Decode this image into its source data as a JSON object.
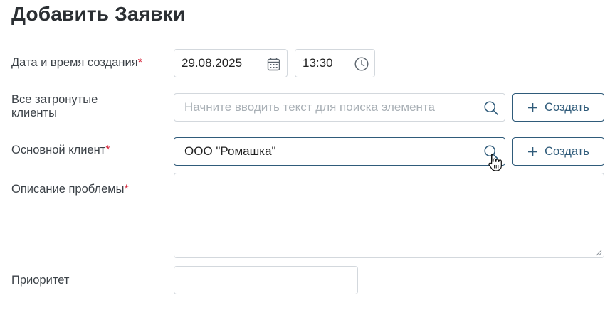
{
  "page": {
    "title": "Добавить Заявки"
  },
  "form": {
    "created": {
      "label": "Дата и время создания",
      "required_mark": "*",
      "date_value": "29.08.2025",
      "time_value": "13:30"
    },
    "affected_clients": {
      "label_line1": "Все затронутые",
      "label_line2": "клиенты",
      "placeholder": "Начните вводить текст для поиска элемента",
      "create_label": "Создать"
    },
    "main_client": {
      "label": "Основной клиент",
      "required_mark": "*",
      "value": "ООО \"Ромашка\"",
      "create_label": "Создать"
    },
    "description": {
      "label": "Описание проблемы",
      "required_mark": "*",
      "value": ""
    },
    "priority": {
      "label": "Приоритет",
      "value": ""
    }
  },
  "icons": {
    "calendar": "calendar-icon",
    "clock": "clock-icon",
    "search": "search-icon",
    "plus": "plus-icon",
    "cursor": "hand-pointer-cursor"
  },
  "colors": {
    "accent": "#2f5b7a",
    "required": "#d6253a",
    "border": "#d3d8dd",
    "placeholder": "#a9b0b6"
  }
}
